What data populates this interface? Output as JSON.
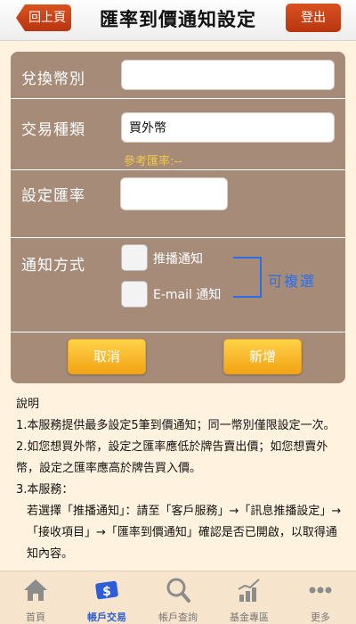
{
  "header": {
    "back_label": "回上頁",
    "title": "匯率到價通知設定",
    "logout_label": "登出"
  },
  "form": {
    "currency_label": "兌換幣別",
    "currency_value": "",
    "trade_type_label": "交易種類",
    "trade_type_value": "買外幣",
    "ref_rate": "參考匯率:--",
    "rate_label": "設定匯率",
    "rate_value": "",
    "notify_label": "通知方式",
    "notify_push": "推播通知",
    "notify_email": "E-mail 通知",
    "multi_select_note": "可複選",
    "cancel_label": "取消",
    "add_label": "新增"
  },
  "notes": {
    "heading": "說明",
    "item1": "1.本服務提供最多設定5筆到價通知；同一幣別僅限設定一次。",
    "item2": "2.如您想買外幣，設定之匯率應低於牌告賣出價；如您想賣外幣，設定之匯率應高於牌告買入價。",
    "item3": "3.本服務：",
    "item3_detail": "若選擇「推播通知」：請至「客戶服務」→「訊息推播設定」→「接收項目」→「匯率到價通知」確認是否已開啟，以取得通知內容。"
  },
  "tabbar": {
    "tabs": [
      {
        "label": "首頁",
        "icon": "home-icon"
      },
      {
        "label": "帳戶交易",
        "icon": "money-card-icon"
      },
      {
        "label": "帳戶查詢",
        "icon": "magnifier-icon"
      },
      {
        "label": "基金專區",
        "icon": "chart-coins-icon"
      },
      {
        "label": "更多",
        "icon": "more-dots-icon"
      }
    ]
  },
  "colors": {
    "accent_red": "#c9431a",
    "panel_brown": "#a58b78",
    "button_orange": "#f5b020",
    "link_blue": "#2c6ee6",
    "active_tab_blue": "#2d5ed8"
  }
}
